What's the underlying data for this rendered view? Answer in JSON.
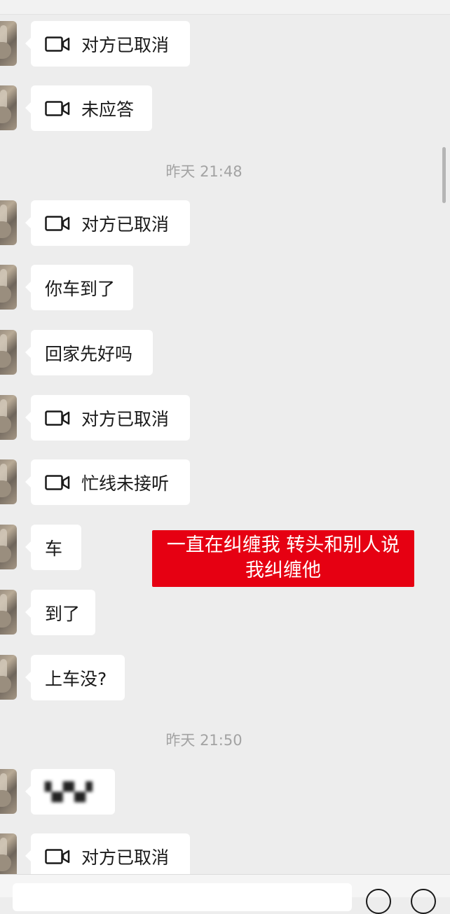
{
  "colors": {
    "background": "#ededed",
    "bubble": "#ffffff",
    "timestamp": "#a3a3a3",
    "overlay": "#e60012"
  },
  "messages": [
    {
      "type": "call",
      "icon": "video-call-icon",
      "text": "对方已取消"
    },
    {
      "type": "call",
      "icon": "video-call-icon",
      "text": "未应答"
    },
    {
      "type": "time",
      "text": "昨天 21:48"
    },
    {
      "type": "call",
      "icon": "video-call-icon",
      "text": "对方已取消"
    },
    {
      "type": "text",
      "text": "你车到了"
    },
    {
      "type": "text",
      "text": "回家先好吗"
    },
    {
      "type": "call",
      "icon": "video-call-icon",
      "text": "对方已取消"
    },
    {
      "type": "call",
      "icon": "video-call-icon",
      "text": "忙线未接听"
    },
    {
      "type": "text",
      "text": "车"
    },
    {
      "type": "text",
      "text": "到了"
    },
    {
      "type": "text",
      "text": "上车没?"
    },
    {
      "type": "time",
      "text": "昨天 21:50"
    },
    {
      "type": "text",
      "text": "▚▞▚▞",
      "blurred": true
    },
    {
      "type": "call",
      "icon": "video-call-icon",
      "text": "对方已取消"
    }
  ],
  "overlay_caption": {
    "line1": "一直在纠缠我 转头和别人说",
    "line2": "我纠缠他"
  }
}
